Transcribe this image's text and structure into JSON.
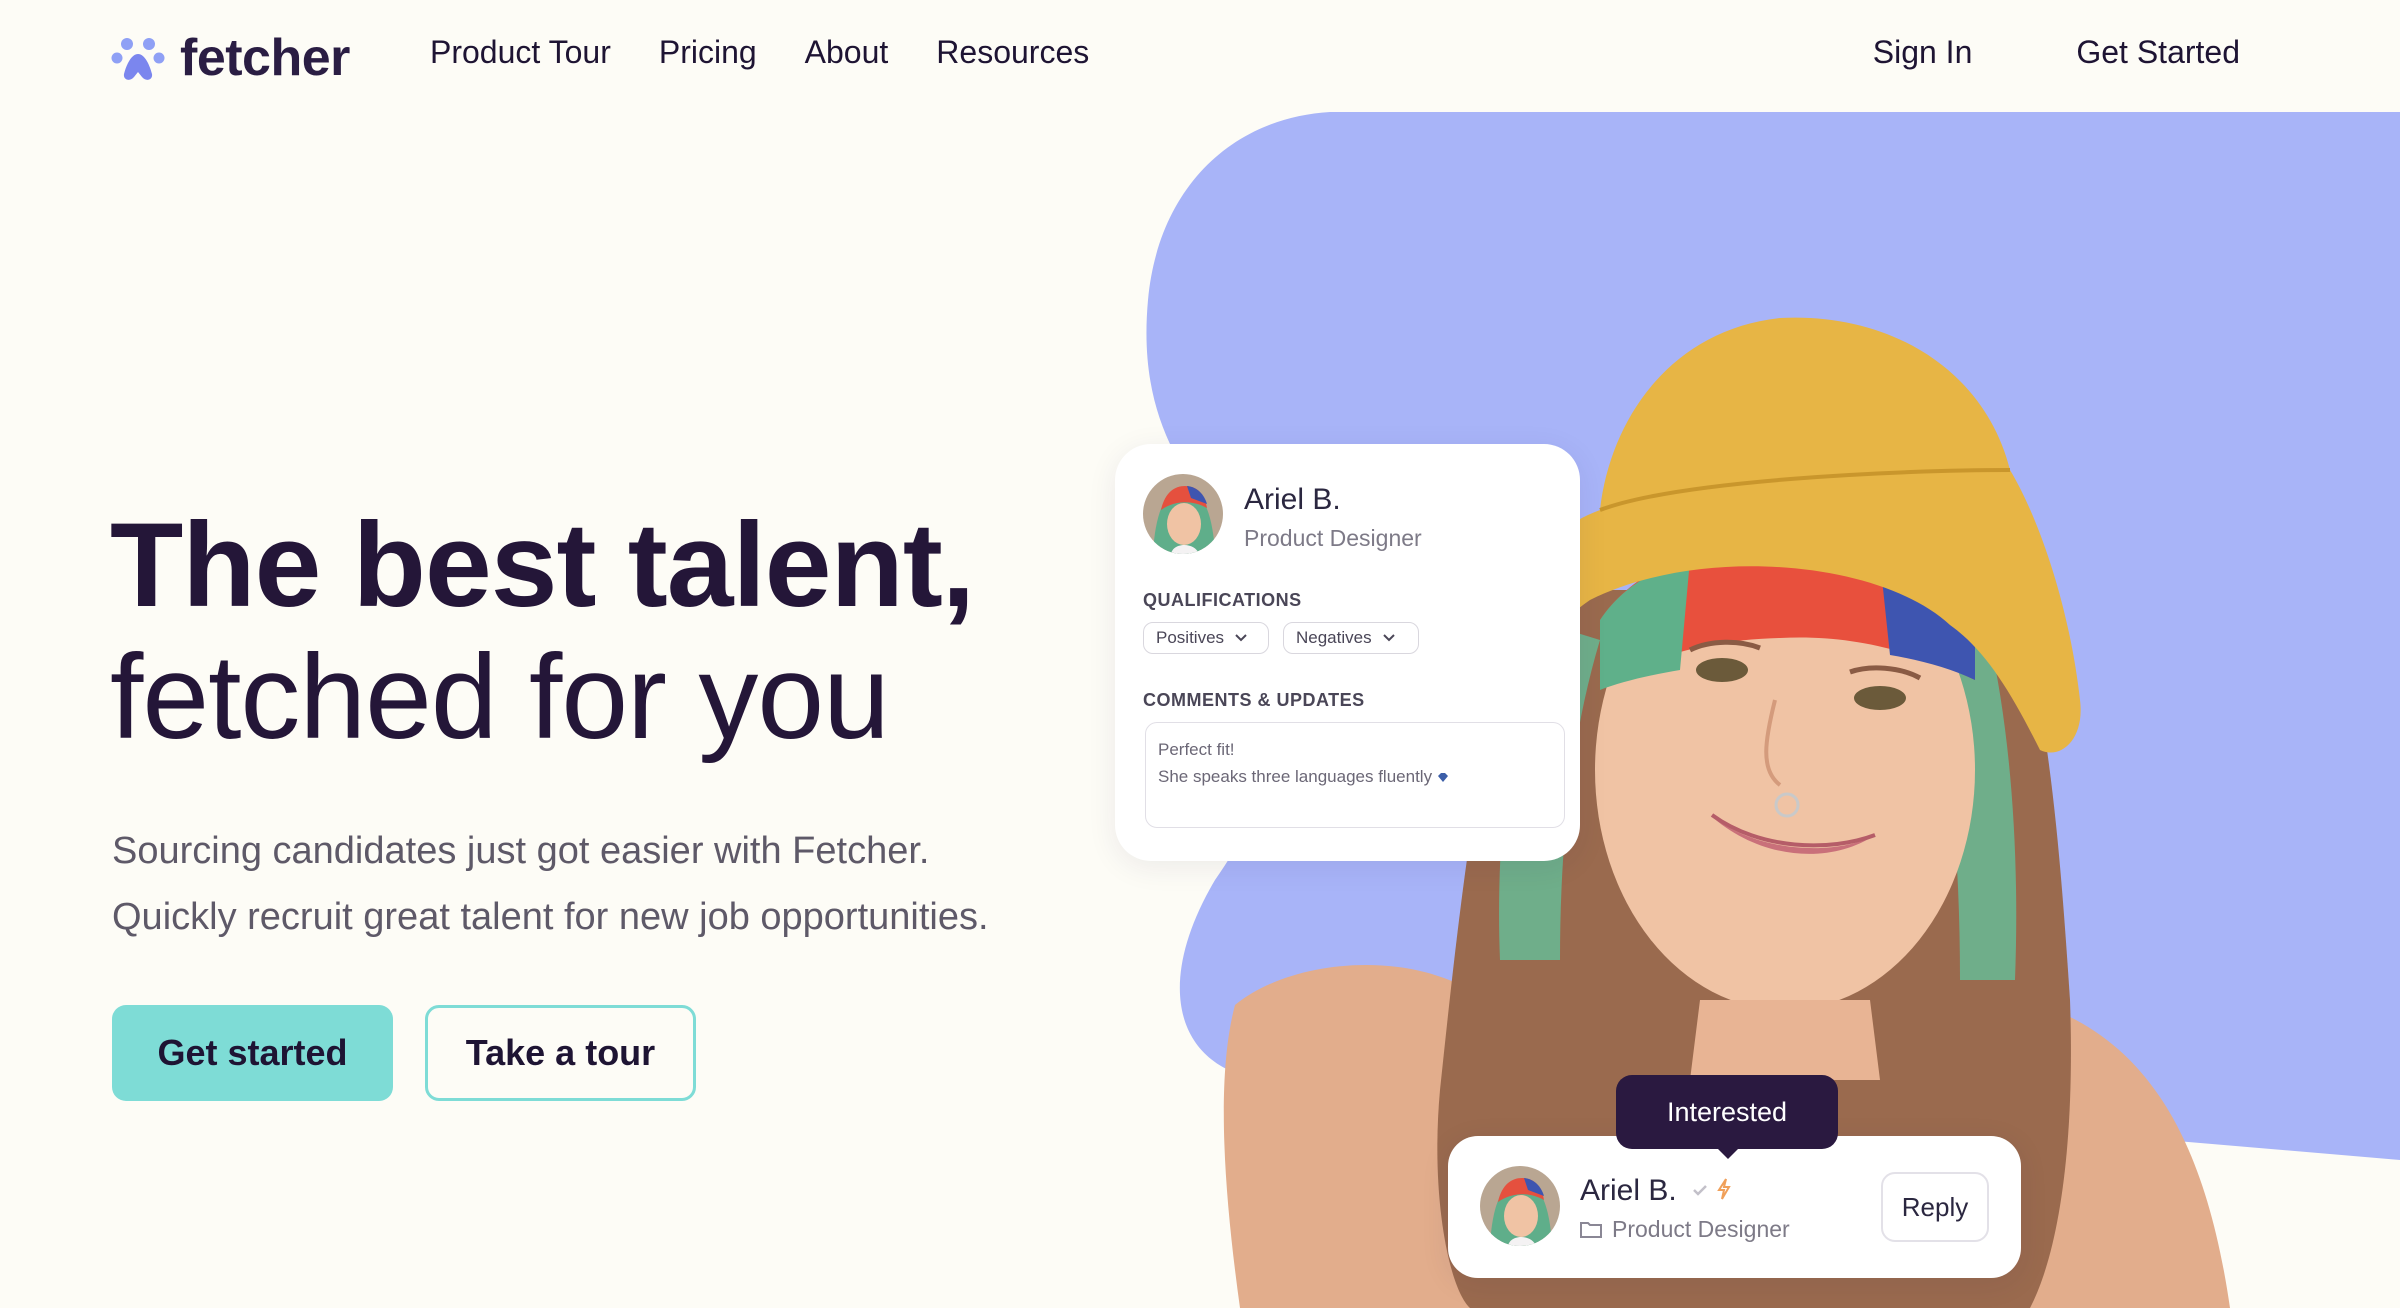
{
  "nav": {
    "brand": "fetcher",
    "links": [
      {
        "label": "Product Tour"
      },
      {
        "label": "Pricing"
      },
      {
        "label": "About"
      },
      {
        "label": "Resources"
      }
    ],
    "sign_in": "Sign In",
    "get_started": "Get Started"
  },
  "hero": {
    "headline_bold": "The best talent,",
    "headline_light": "fetched for you",
    "subtitle_line1": "Sourcing candidates just got easier with Fetcher.",
    "subtitle_line2": "Quickly recruit great talent for new job opportunities.",
    "primary_button": "Get started",
    "secondary_button": "Take a tour"
  },
  "profile_card": {
    "name": "Ariel B.",
    "role": "Product Designer",
    "qualifications_label": "QUALIFICATIONS",
    "positives_label": "Positives",
    "negatives_label": "Negatives",
    "comments_label": "COMMENTS & UPDATES",
    "comment_line1": "Perfect fit!",
    "comment_line2": "She speaks three languages fluently"
  },
  "message_card": {
    "status_tooltip": "Interested",
    "name": "Ariel B.",
    "role": "Product Designer",
    "reply_button": "Reply"
  },
  "colors": {
    "background": "#fdfcf6",
    "accent_teal": "#7edcd6",
    "blob_periwinkle": "#a8b4f8",
    "brand_dark": "#241638",
    "tooltip_dark": "#2a1940",
    "hat_yellow": "#e7b545"
  },
  "icons": {
    "logo": "paw-print-icon",
    "chevron": "chevron-down-icon",
    "verified": "checkmark-icon",
    "lightning": "lightning-icon",
    "folder": "folder-icon",
    "gem": "gem-icon"
  }
}
